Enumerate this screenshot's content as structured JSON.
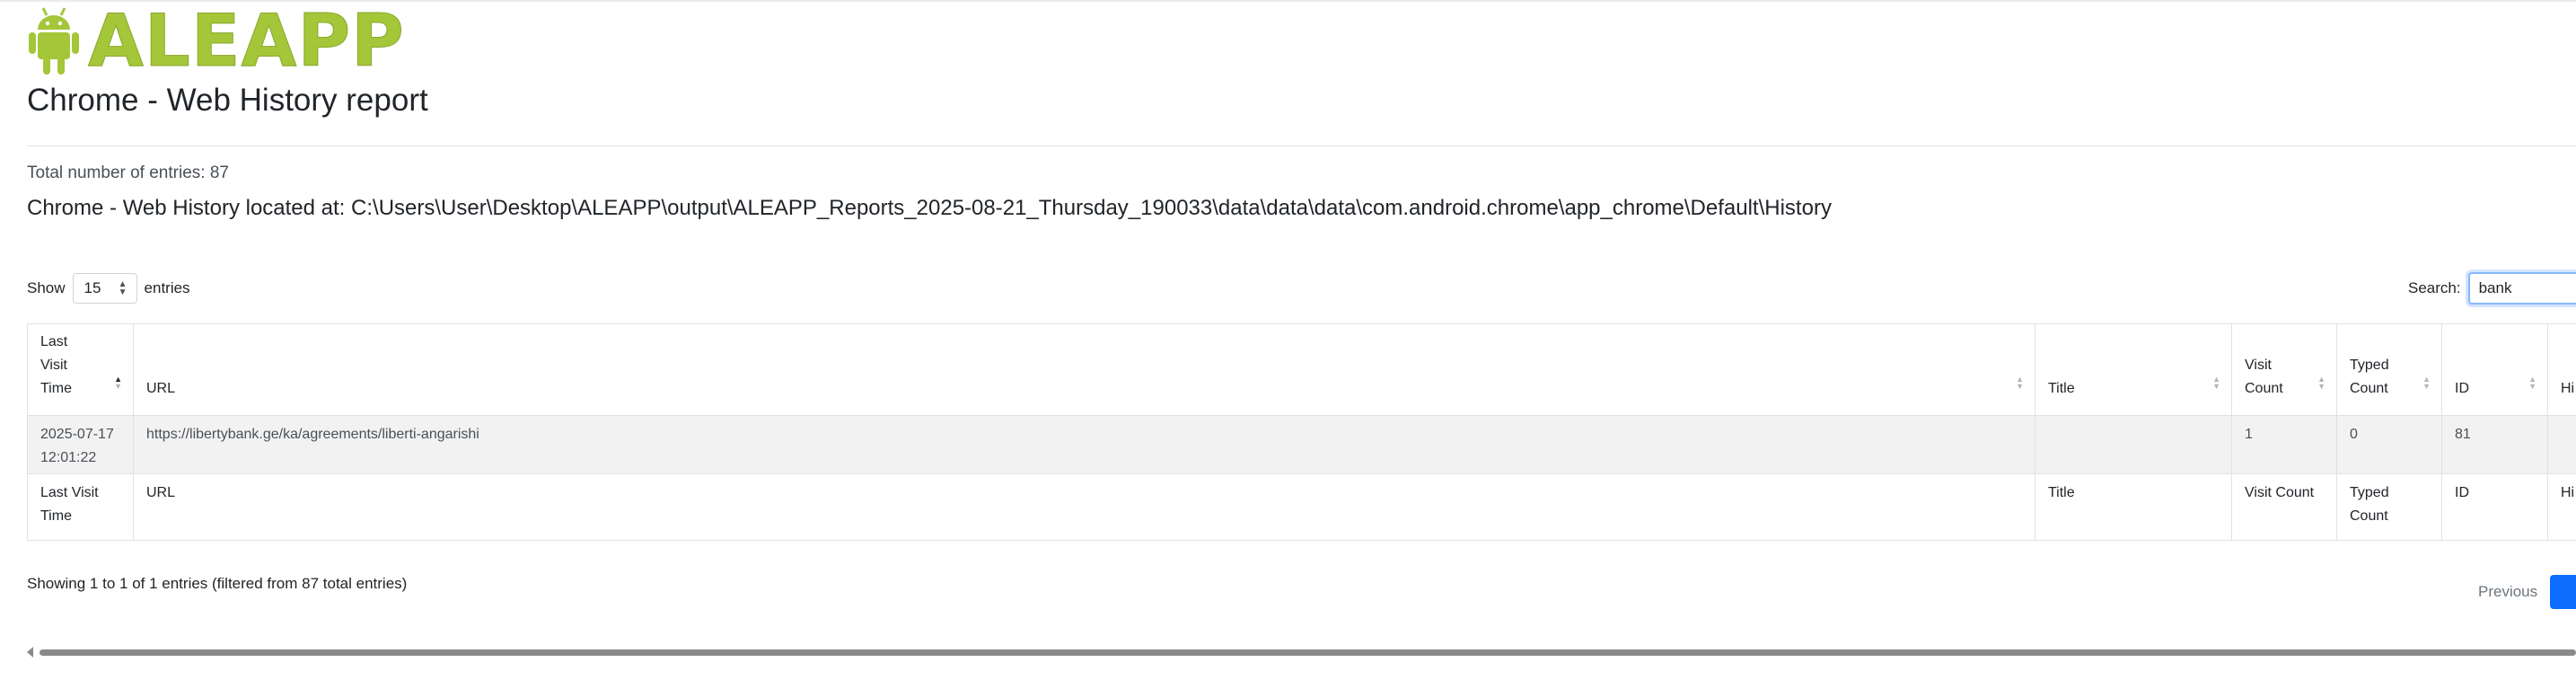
{
  "header": {
    "logo_text": "ALEAPP",
    "report_title": "Chrome - Web History report",
    "total_entries": "Total number of entries: 87",
    "location": "Chrome - Web History located at: C:\\Users\\User\\Desktop\\ALEAPP\\output\\ALEAPP_Reports_2025-08-21_Thursday_190033\\data\\data\\data\\com.android.chrome\\app_chrome\\Default\\History"
  },
  "controls": {
    "show_label": "Show",
    "length_value": "15",
    "entries_label": "entries",
    "search_label": "Search:",
    "search_value": "bank"
  },
  "table": {
    "headers": [
      "Last Visit Time",
      "URL",
      "Title",
      "Visit Count",
      "Typed Count",
      "ID",
      "Hi"
    ],
    "rows": [
      {
        "last_visit_time": "2025-07-17 12:01:22",
        "url": "https://libertybank.ge/ka/agreements/liberti-angarishi",
        "title": "",
        "visit_count": "1",
        "typed_count": "0",
        "id": "81",
        "hidden": ""
      }
    ],
    "footers": [
      "Last Visit Time",
      "URL",
      "Title",
      "Visit Count",
      "Typed Count",
      "ID",
      "Hi"
    ]
  },
  "footer": {
    "info": "Showing 1 to 1 of 1 entries (filtered from 87 total entries)",
    "previous_label": "Previous"
  },
  "colors": {
    "logo_green": "#a4c639",
    "accent_blue": "#0d6efd",
    "row_bg": "#f2f2f2"
  },
  "icons": {
    "logo": "android-robot-icon",
    "sort": "sort-arrows-icon"
  }
}
